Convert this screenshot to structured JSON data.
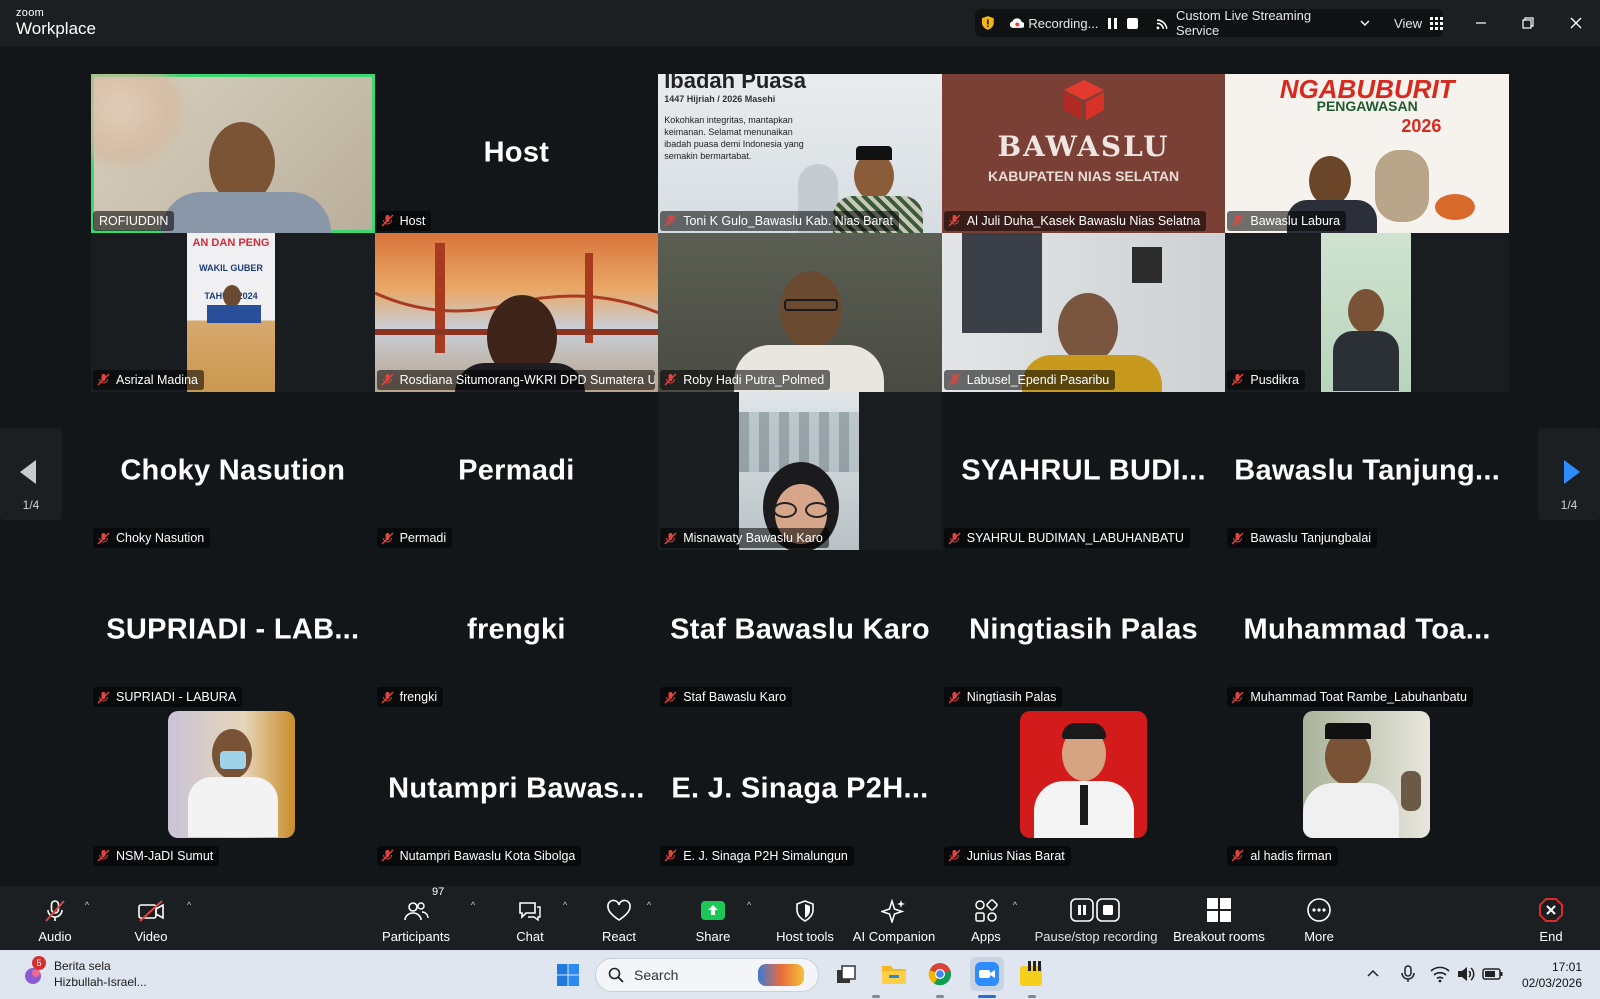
{
  "app": {
    "brand_top": "zoom",
    "brand_bottom": "Workplace"
  },
  "titlebar": {
    "recording_label": "Recording...",
    "stream_label": "Custom Live Streaming Service",
    "view_label": "View"
  },
  "pages": {
    "left": "1/4",
    "right": "1/4"
  },
  "tiles": [
    {
      "label": "ROFIUDDIN",
      "big": ""
    },
    {
      "label": "Host",
      "big": "Host"
    },
    {
      "label": "Toni K Gulo_Bawaslu Kab. Nias Barat",
      "big": ""
    },
    {
      "label": "Al Juli Duha_Kasek Bawaslu Nias Selatna",
      "big": ""
    },
    {
      "label": "Bawaslu Labura",
      "big": ""
    },
    {
      "label": "Asrizal Madina",
      "big": ""
    },
    {
      "label": "Rosdiana Situmorang-WKRI DPD Sumatera U...",
      "big": ""
    },
    {
      "label": "Roby Hadi Putra_Polmed",
      "big": ""
    },
    {
      "label": "Labusel_Ependi Pasaribu",
      "big": ""
    },
    {
      "label": "Pusdikra",
      "big": ""
    },
    {
      "label": "Choky Nasution",
      "big": "Choky Nasution"
    },
    {
      "label": "Permadi",
      "big": "Permadi"
    },
    {
      "label": "Misnawaty Bawaslu Karo",
      "big": ""
    },
    {
      "label": "SYAHRUL BUDIMAN_LABUHANBATU",
      "big": "SYAHRUL BUDI..."
    },
    {
      "label": "Bawaslu Tanjungbalai",
      "big": "Bawaslu Tanjung..."
    },
    {
      "label": "SUPRIADI - LABURA",
      "big": "SUPRIADI - LAB..."
    },
    {
      "label": "frengki",
      "big": "frengki"
    },
    {
      "label": "Staf Bawaslu Karo",
      "big": "Staf Bawaslu Karo"
    },
    {
      "label": "Ningtiasih Palas",
      "big": "Ningtiasih Palas"
    },
    {
      "label": "Muhammad Toat Rambe_Labuhanbatu",
      "big": "Muhammad Toa..."
    },
    {
      "label": "NSM-JaDI Sumut",
      "big": ""
    },
    {
      "label": "Nutampri Bawaslu Kota Sibolga",
      "big": "Nutampri Bawas..."
    },
    {
      "label": "E. J. Sinaga P2H Simalungun",
      "big": "E. J. Sinaga P2H..."
    },
    {
      "label": "Junius Nias Barat",
      "big": ""
    },
    {
      "label": "al hadis firman",
      "big": ""
    }
  ],
  "slides": {
    "toni_title": "Ibadah Puasa",
    "toni_sub": "1447 Hijriah / 2026 Masehi",
    "toni_body": "Kokohkan integritas, mantapkan keimanan. Selamat menunaikan ibadah puasa demi Indonesia yang semakin bermartabat.",
    "bawaslu_line1": "BAWASLU",
    "bawaslu_line2": "KABUPATEN NIAS SELATAN",
    "ngabuburit_line1": "NGABUBURIT",
    "ngabuburit_line2": "PENGAWASAN",
    "ngabuburit_year": "2026",
    "asrizal_banner1": "AN DAN PENG",
    "asrizal_banner2": "WAKIL GUBER",
    "asrizal_banner3": "TAHUN 2024"
  },
  "toolbar": {
    "audio": "Audio",
    "video": "Video",
    "participants": "Participants",
    "participants_count": "97",
    "chat": "Chat",
    "react": "React",
    "share": "Share",
    "host_tools": "Host tools",
    "ai_companion": "AI Companion",
    "apps": "Apps",
    "pause_stop": "Pause/stop recording",
    "breakout": "Breakout rooms",
    "more": "More",
    "end": "End"
  },
  "taskbar": {
    "news_title": "Berita sela",
    "news_sub": "Hizbullah-Israel...",
    "news_badge": "5",
    "search_placeholder": "Search",
    "time": "17:01",
    "date": "02/03/2026"
  },
  "colors": {
    "active_speaker": "#3cd672",
    "share_green": "#1cc758",
    "end_red": "#e02828",
    "muted_red": "#e0463f",
    "arrow_blue": "#2d8cff"
  }
}
